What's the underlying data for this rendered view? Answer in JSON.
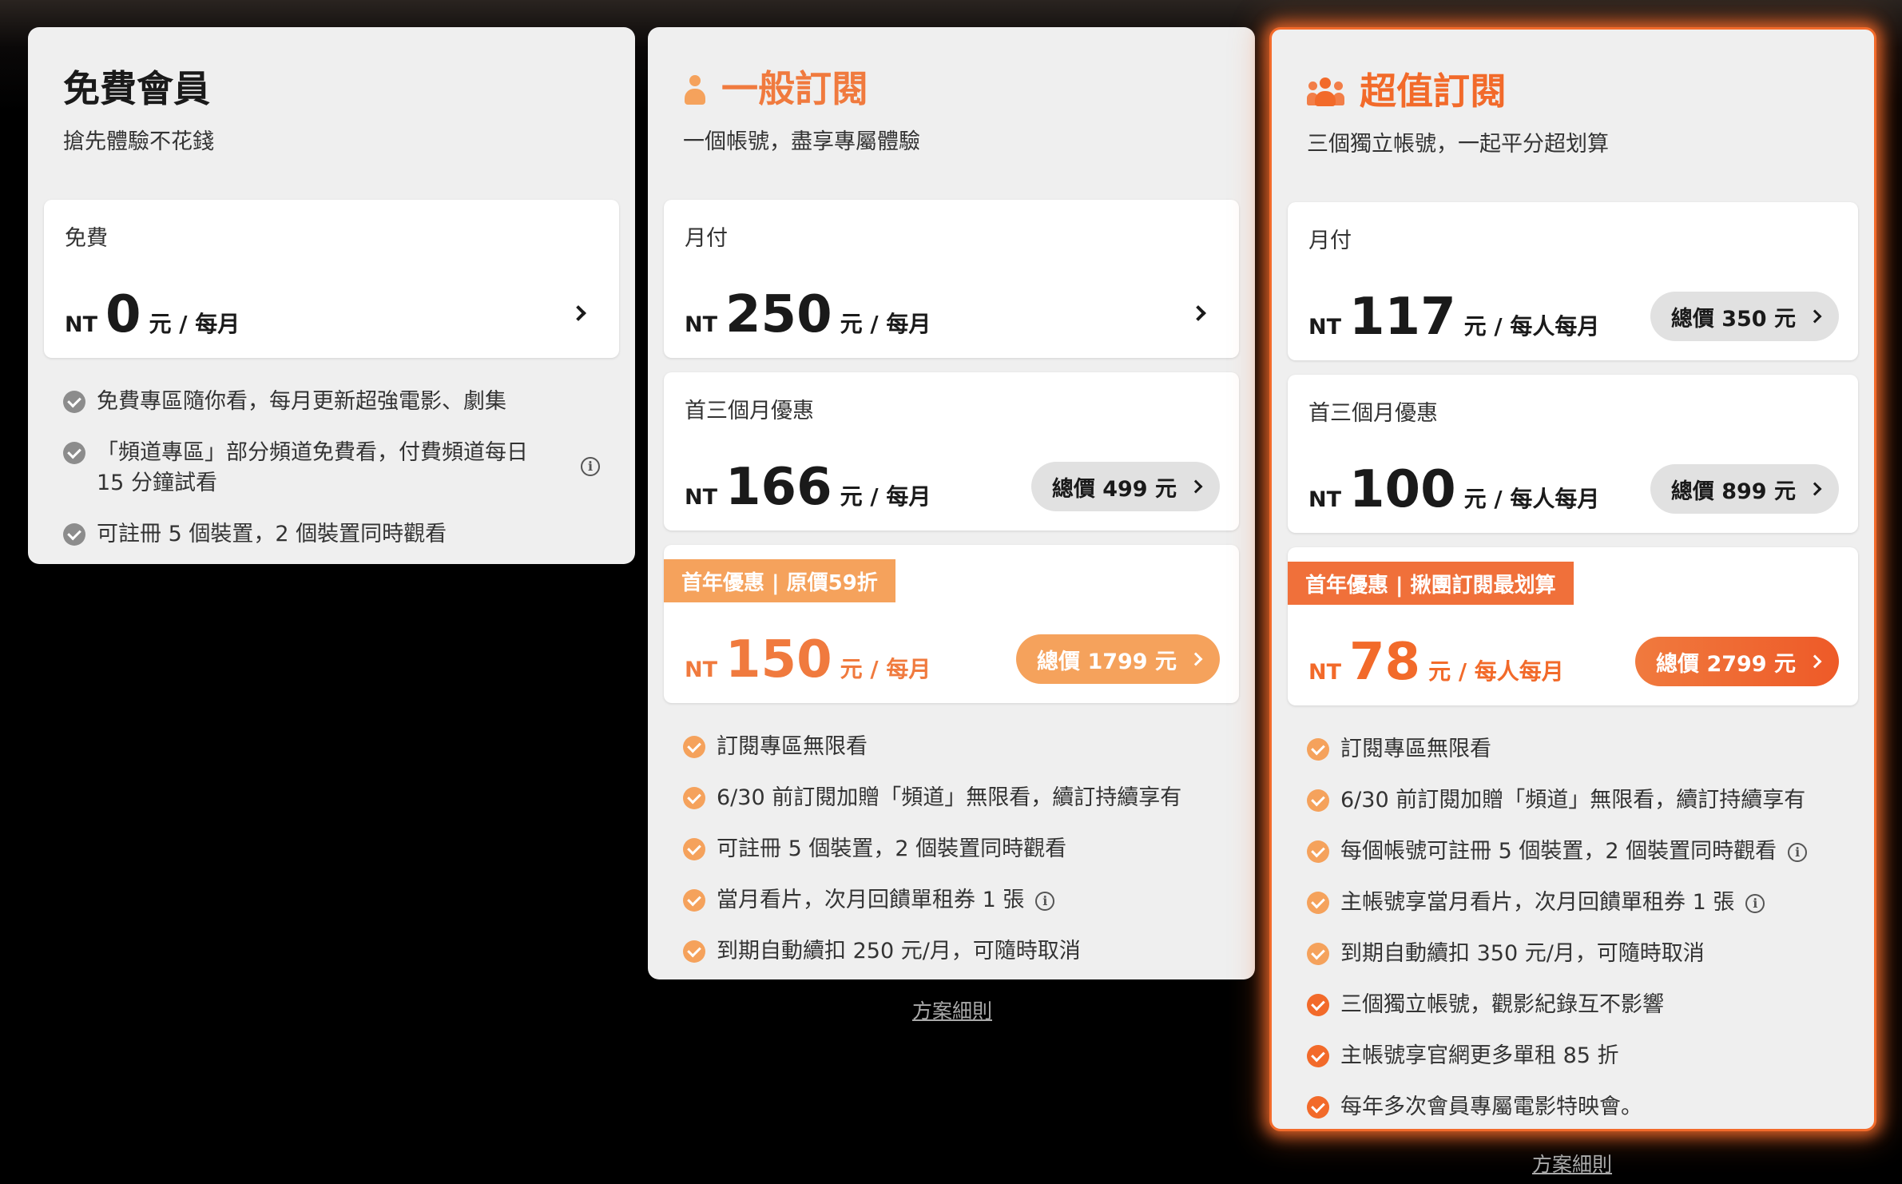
{
  "plans": {
    "free": {
      "title": "免費會員",
      "subtitle": "搶先體驗不花錢",
      "options": [
        {
          "label": "免費",
          "nt": "NT",
          "amount": "0",
          "unit": "元 / 每月"
        }
      ],
      "features": [
        "免費專區隨你看，每月更新超強電影、劇集",
        "「頻道專區」部分頻道免費看，付費頻道每日 15 分鐘試看",
        "可註冊 5 個裝置，2 個裝置同時觀看"
      ]
    },
    "standard": {
      "title": "一般訂閱",
      "subtitle": "一個帳號，盡享專屬體驗",
      "options": [
        {
          "label": "月付",
          "nt": "NT",
          "amount": "250",
          "unit": "元 / 每月"
        },
        {
          "label": "首三個月優惠",
          "nt": "NT",
          "amount": "166",
          "unit": "元 / 每月",
          "total": "總價 499 元"
        },
        {
          "tag": "首年優惠 | 原價59折",
          "nt": "NT",
          "amount": "150",
          "unit": "元 / 每月",
          "total": "總價 1799 元"
        }
      ],
      "features": [
        "訂閱專區無限看",
        "6/30 前訂閱加贈「頻道」無限看，續訂持續享有",
        "可註冊 5 個裝置，2 個裝置同時觀看",
        "當月看片，次月回饋單租券 1 張",
        "到期自動續扣 250 元/月，可隨時取消"
      ],
      "details_link": "方案細則"
    },
    "premium": {
      "title": "超值訂閱",
      "subtitle": "三個獨立帳號，一起平分超划算",
      "options": [
        {
          "label": "月付",
          "nt": "NT",
          "amount": "117",
          "unit": "元 / 每人每月",
          "total": "總價 350 元"
        },
        {
          "label": "首三個月優惠",
          "nt": "NT",
          "amount": "100",
          "unit": "元 / 每人每月",
          "total": "總價 899 元"
        },
        {
          "tag": "首年優惠 | 揪團訂閱最划算",
          "nt": "NT",
          "amount": "78",
          "unit": "元 / 每人每月",
          "total": "總價 2799 元"
        }
      ],
      "features": [
        "訂閱專區無限看",
        "6/30 前訂閱加贈「頻道」無限看，續訂持續享有",
        "每個帳號可註冊 5 個裝置，2 個裝置同時觀看",
        "主帳號享當月看片，次月回饋單租券 1 張",
        "到期自動續扣 350 元/月，可隨時取消",
        "三個獨立帳號，觀影紀錄互不影響",
        "主帳號享官網更多單租 85 折",
        "每年多次會員專屬電影特映會。"
      ],
      "details_link": "方案細則"
    }
  },
  "icons": {
    "standard_title": "user-icon",
    "premium_title": "users-group-icon",
    "feature_free": "check-circle-icon",
    "info": "info-icon",
    "arrow": "chevron-right-icon"
  },
  "colors": {
    "accent_gold": "#f5a25c",
    "accent_orange": "#f26a2a",
    "card_bg": "#efefef"
  }
}
